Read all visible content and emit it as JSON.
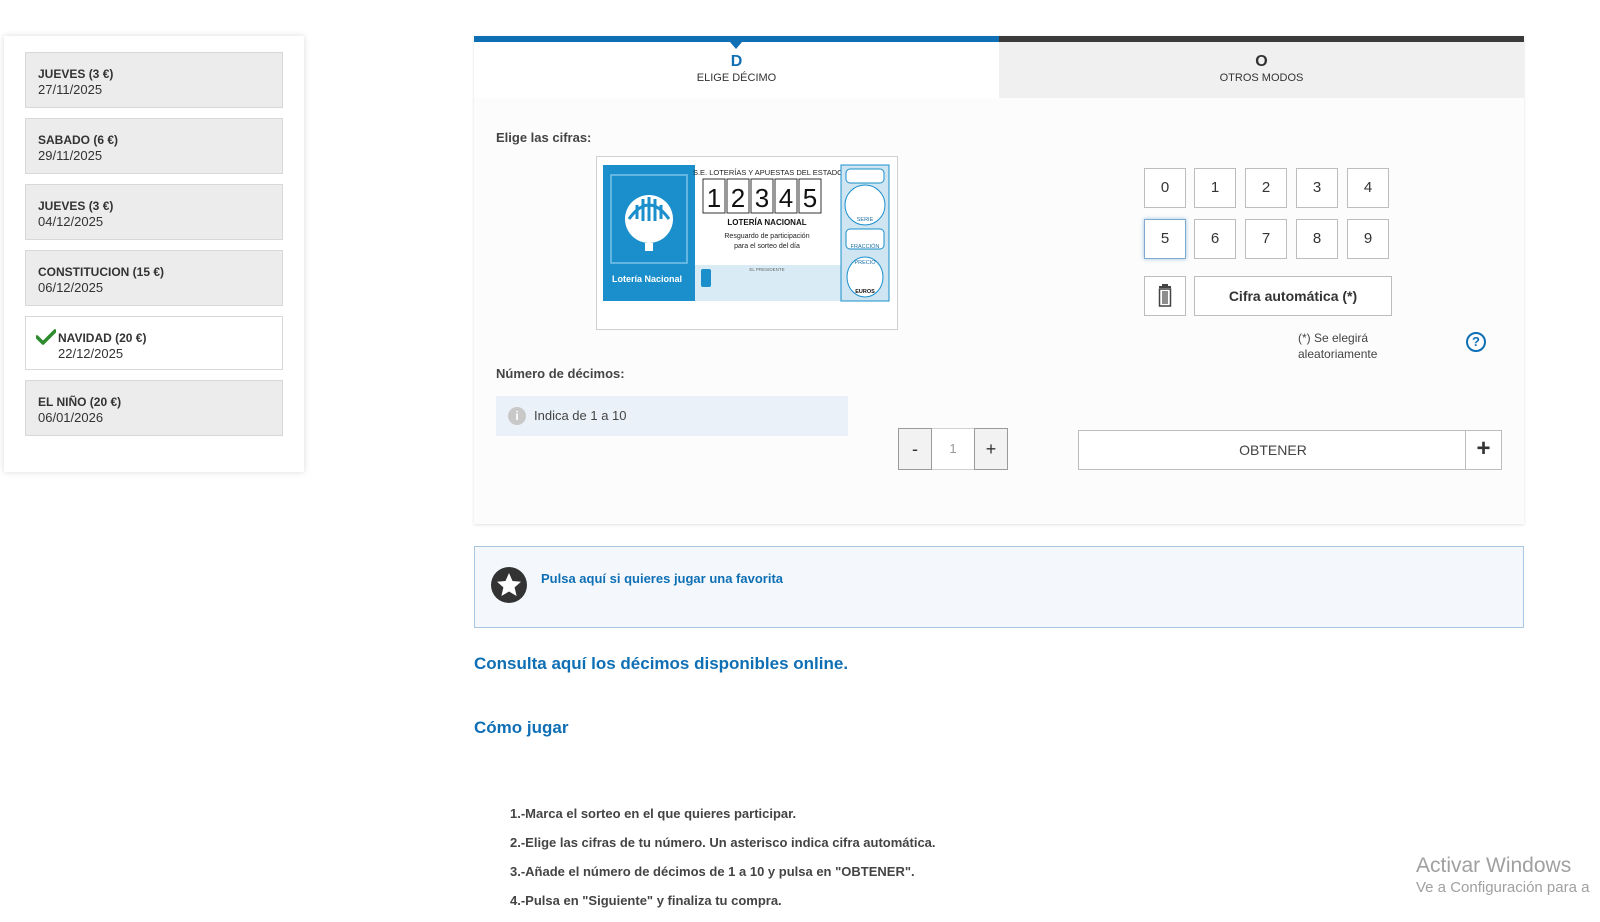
{
  "sidebar": {
    "draws": [
      {
        "name": "JUEVES (3 €)",
        "date": "27/11/2025",
        "selected": false
      },
      {
        "name": "SABADO (6 €)",
        "date": "29/11/2025",
        "selected": false
      },
      {
        "name": "JUEVES (3 €)",
        "date": "04/12/2025",
        "selected": false
      },
      {
        "name": "CONSTITUCION (15 €)",
        "date": "06/12/2025",
        "selected": false
      },
      {
        "name": "NAVIDAD (20 €)",
        "date": "22/12/2025",
        "selected": true
      },
      {
        "name": "EL NIÑO (20 €)",
        "date": "06/01/2026",
        "selected": false
      }
    ]
  },
  "tabs": [
    {
      "letter": "D",
      "label": "ELIGE DÉCIMO",
      "active": true
    },
    {
      "letter": "O",
      "label": "OTROS MODOS",
      "active": false
    }
  ],
  "picker": {
    "label": "Elige las cifras:",
    "ticket": {
      "header": "S.E. LOTERÍAS Y APUESTAS DEL ESTADO",
      "digits": [
        "1",
        "2",
        "3",
        "4",
        "5"
      ],
      "title": "LOTERÍA NACIONAL",
      "subtitle1": "Resguardo de participación",
      "subtitle2": "para el sorteo del día",
      "brand": "Lotería Nacional",
      "serie": "SERIE",
      "fraccion": "FRACCIÓN",
      "precio": "PRECIO",
      "euros": "EUROS",
      "signature": "EL PRESIDENTE"
    },
    "keypad": [
      "0",
      "1",
      "2",
      "3",
      "4",
      "5",
      "6",
      "7",
      "8",
      "9"
    ],
    "focused_key": "5",
    "auto_label": "Cifra automática (*)",
    "auto_note": "(*) Se elegirá aleatoriamente",
    "help": "?"
  },
  "quantity": {
    "label": "Número de décimos:",
    "hint": "Indica de 1 a 10",
    "minus": "-",
    "plus": "+",
    "value": "1"
  },
  "obtener": {
    "label": "OBTENER",
    "plus": "+"
  },
  "favorite": {
    "text": "Pulsa aquí si quieres jugar una favorita"
  },
  "links": {
    "available": "Consulta aquí los décimos disponibles online.",
    "how_to": "Cómo jugar"
  },
  "steps": [
    "1.-Marca el sorteo en el que quieres participar.",
    "2.-Elige las cifras de tu número. Un asterisco indica cifra automática.",
    "3.-Añade el número de décimos de 1 a 10 y pulsa en \"OBTENER\".",
    "4.-Pulsa en \"Siguiente\" y finaliza tu compra."
  ],
  "watermark": {
    "line1": "Activar Windows",
    "line2": "Ve a Configuración para a"
  },
  "colors": {
    "accent": "#0f6fb5",
    "selected_check": "#2e8b2e"
  }
}
